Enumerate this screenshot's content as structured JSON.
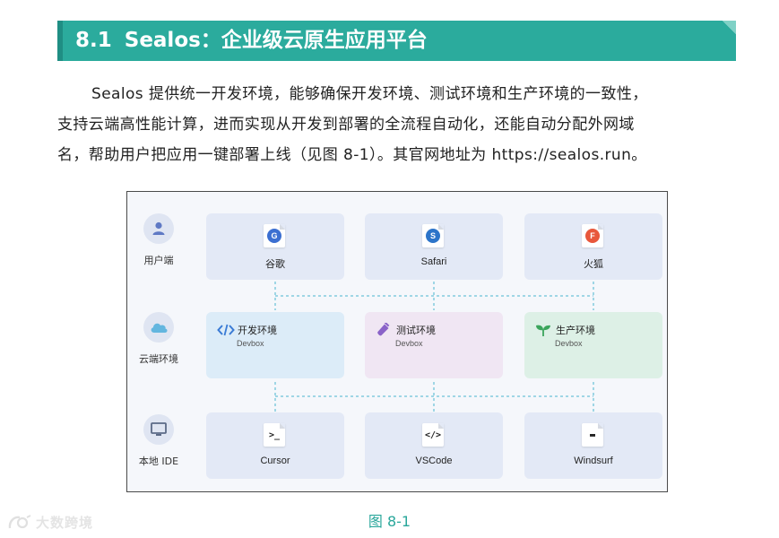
{
  "section": {
    "number": "8.1",
    "title": "Sealos：企业级云原生应用平台",
    "colors": {
      "bar": "#2bab9d",
      "bar_dark": "#1f8e84"
    }
  },
  "paragraph": {
    "lines": [
      "Sealos 提供统一开发环境，能够确保开发环境、测试环境和生产环境的一致性，",
      "支持云端高性能计算，进而实现从开发到部署的全流程自动化，还能自动分配外网域",
      "名，帮助用户把应用一键部署上线（见图 8-1）。其官网地址为 https://sealos.run。"
    ]
  },
  "figure": {
    "rows": [
      {
        "label": "用户端",
        "icon": "user-icon"
      },
      {
        "label": "云端环境",
        "icon": "cloud-icon"
      },
      {
        "label": "本地 IDE",
        "icon": "monitor-icon"
      }
    ],
    "clients": [
      {
        "label": "谷歌",
        "badge": "G",
        "color": "#3b6fd1",
        "icon": "google-chrome-icon"
      },
      {
        "label": "Safari",
        "badge": "S",
        "color": "#2c74c9",
        "icon": "safari-icon"
      },
      {
        "label": "火狐",
        "badge": "F",
        "color": "#e8573b",
        "icon": "firefox-icon"
      }
    ],
    "environments": [
      {
        "title": "开发环境",
        "sub": "Devbox",
        "icon": "code-icon",
        "color": "#3a7bd5"
      },
      {
        "title": "测试环境",
        "sub": "Devbox",
        "icon": "test-tube-icon",
        "color": "#8a63c8"
      },
      {
        "title": "生产环境",
        "sub": "Devbox",
        "icon": "sprout-icon",
        "color": "#3ba55c"
      }
    ],
    "ides": [
      {
        "label": "Cursor",
        "glyph": ">_",
        "icon": "terminal-icon"
      },
      {
        "label": "VSCode",
        "glyph": "</>",
        "icon": "vscode-icon"
      },
      {
        "label": "Windsurf",
        "glyph": "▬",
        "icon": "window-icon"
      }
    ],
    "caption": "图 8-1"
  },
  "watermark": {
    "text": "大数跨境"
  }
}
